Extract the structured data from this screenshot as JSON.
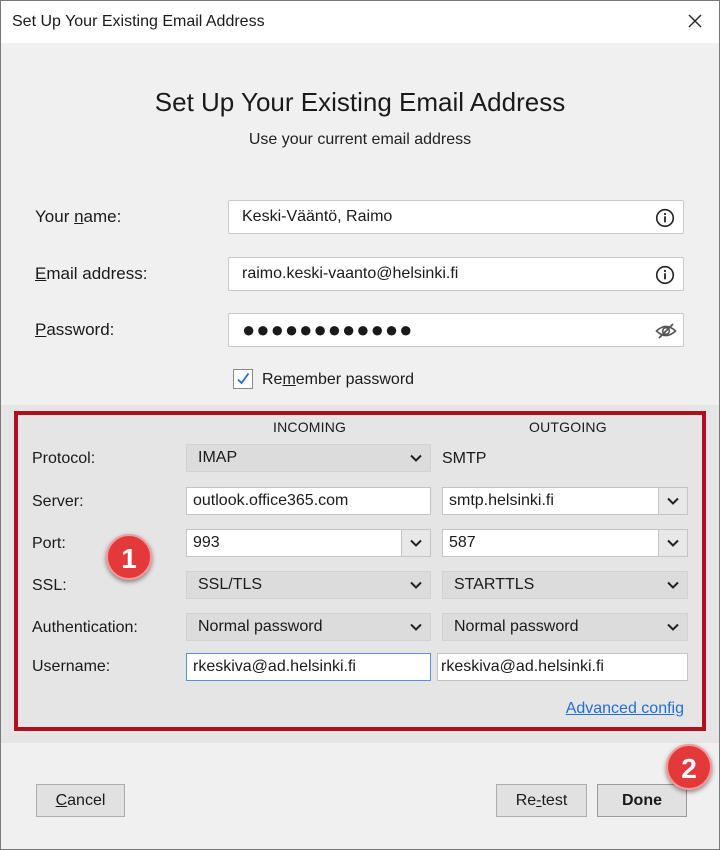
{
  "window": {
    "title": "Set Up Your Existing Email Address"
  },
  "header": {
    "title": "Set Up Your Existing Email Address",
    "subtitle": "Use your current email address"
  },
  "form": {
    "name_label_pre": "Your ",
    "name_label_mn": "n",
    "name_label_post": "ame:",
    "name_value": "Keski-Vääntö, Raimo",
    "email_label_mn": "E",
    "email_label_post": "mail address:",
    "email_value": "raimo.keski-vaanto@helsinki.fi",
    "password_label_mn": "P",
    "password_label_post": "assword:",
    "password_value": "●●●●●●●●●●●●",
    "remember_pre": "Re",
    "remember_mn": "m",
    "remember_post": "ember password",
    "remember_checked": true
  },
  "server": {
    "incoming_header": "INCOMING",
    "outgoing_header": "OUTGOING",
    "protocol_label": "Protocol:",
    "protocol_in": "IMAP",
    "protocol_out": "SMTP",
    "server_label": "Server:",
    "server_in": "outlook.office365.com",
    "server_out": "smtp.helsinki.fi",
    "port_label": "Port:",
    "port_in": "993",
    "port_out": "587",
    "ssl_label": "SSL:",
    "ssl_in": "SSL/TLS",
    "ssl_out": "STARTTLS",
    "auth_label": "Authentication:",
    "auth_in": "Normal password",
    "auth_out": "Normal password",
    "username_label": "Username:",
    "username_in": "rkeskiva@ad.helsinki.fi",
    "username_out": "rkeskiva@ad.helsinki.fi",
    "advanced_link": "Advanced config"
  },
  "annotations": {
    "badge1": "1",
    "badge2": "2",
    "highlight_color": "#b0101e",
    "badge_color": "#e4393b"
  },
  "buttons": {
    "cancel_mn": "C",
    "cancel_post": "ancel",
    "retest_pre": "Re",
    "retest_mn": "-",
    "retest_post": "test",
    "done": "Done"
  },
  "colors": {
    "accent": "#1f6fd1",
    "check": "#1f6fd1"
  }
}
